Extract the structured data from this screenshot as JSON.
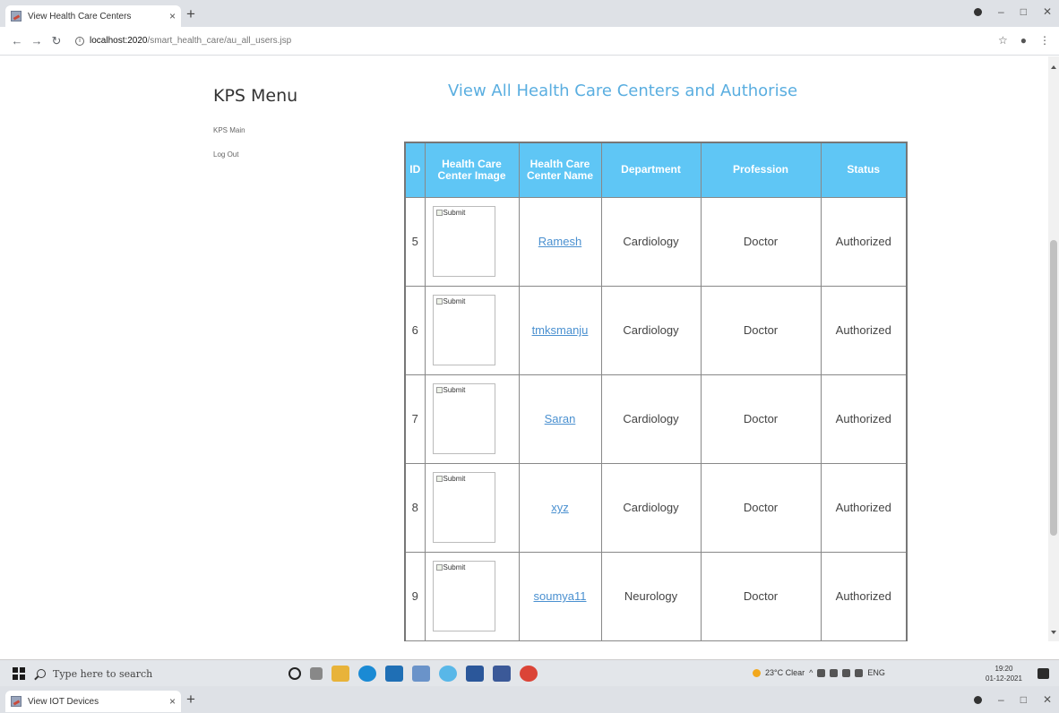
{
  "browser": {
    "tab_title": "View Health Care Centers",
    "tab_close": "×",
    "new_tab": "+",
    "url_host": "localhost:2020",
    "url_path": "/smart_health_care/au_all_users.jsp"
  },
  "sidebar": {
    "title": "KPS Menu",
    "links": [
      "KPS Main",
      "Log Out"
    ]
  },
  "main": {
    "title": "View All Health Care Centers and Authorise",
    "table": {
      "headers": [
        "ID",
        "Health Care Center Image",
        "Health Care Center Name",
        "Department",
        "Profession",
        "Status"
      ],
      "header_img_l1": "Health Care",
      "header_img_l2": "Center Image",
      "header_name_l1": "Health Care",
      "header_name_l2": "Center Name",
      "image_alt": "Submit",
      "rows": [
        {
          "id": "5",
          "name": "Ramesh",
          "department": "Cardiology",
          "profession": "Doctor",
          "status": "Authorized"
        },
        {
          "id": "6",
          "name": "tmksmanju",
          "department": "Cardiology",
          "profession": "Doctor",
          "status": "Authorized"
        },
        {
          "id": "7",
          "name": "Saran",
          "department": "Cardiology",
          "profession": "Doctor",
          "status": "Authorized"
        },
        {
          "id": "8",
          "name": "xyz",
          "department": "Cardiology",
          "profession": "Doctor",
          "status": "Authorized"
        },
        {
          "id": "9",
          "name": "soumya11",
          "department": "Neurology",
          "profession": "Doctor",
          "status": "Authorized"
        },
        {
          "id": "",
          "name": "",
          "department": "",
          "profession": "",
          "status": ""
        }
      ]
    }
  },
  "taskbar": {
    "search_placeholder": "Type here to search",
    "weather": "23°C  Clear",
    "lang": "ENG",
    "time": "19:20",
    "date": "01-12-2021",
    "notif_count": "14"
  },
  "second_window": {
    "tab_title": "View IOT Devices"
  },
  "colors": {
    "header_bg": "#5fc6f5",
    "title": "#5aaee0",
    "link": "#4a90d0"
  }
}
